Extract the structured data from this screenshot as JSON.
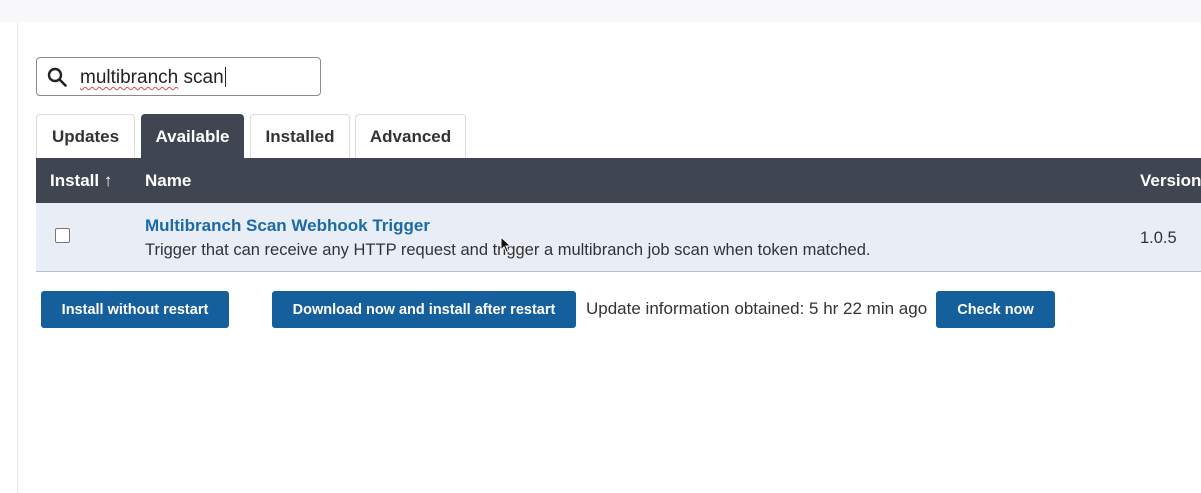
{
  "search": {
    "value_misspelled": "multibranch",
    "value_rest": " scan"
  },
  "tabs": [
    {
      "label": "Updates",
      "active": false
    },
    {
      "label": "Available",
      "active": true
    },
    {
      "label": "Installed",
      "active": false
    },
    {
      "label": "Advanced",
      "active": false
    }
  ],
  "table": {
    "columns": {
      "install": "Install ↑",
      "name": "Name",
      "version": "Version"
    },
    "rows": [
      {
        "checked": false,
        "name": "Multibranch Scan Webhook Trigger",
        "description": "Trigger that can receive any HTTP request and trigger a multibranch job scan when token matched.",
        "version": "1.0.5"
      }
    ]
  },
  "actions": {
    "install_without_restart": "Install without restart",
    "download_install_after_restart": "Download now and install after restart",
    "update_info": "Update information obtained: 5 hr 22 min ago",
    "check_now": "Check now"
  },
  "colors": {
    "header_bg": "#3f4551",
    "row_bg": "#e8edf6",
    "button_bg": "#145f9c",
    "link": "#1c6aa6"
  },
  "icons": {
    "search": "search-icon",
    "pointer": "mouse-pointer-icon"
  }
}
